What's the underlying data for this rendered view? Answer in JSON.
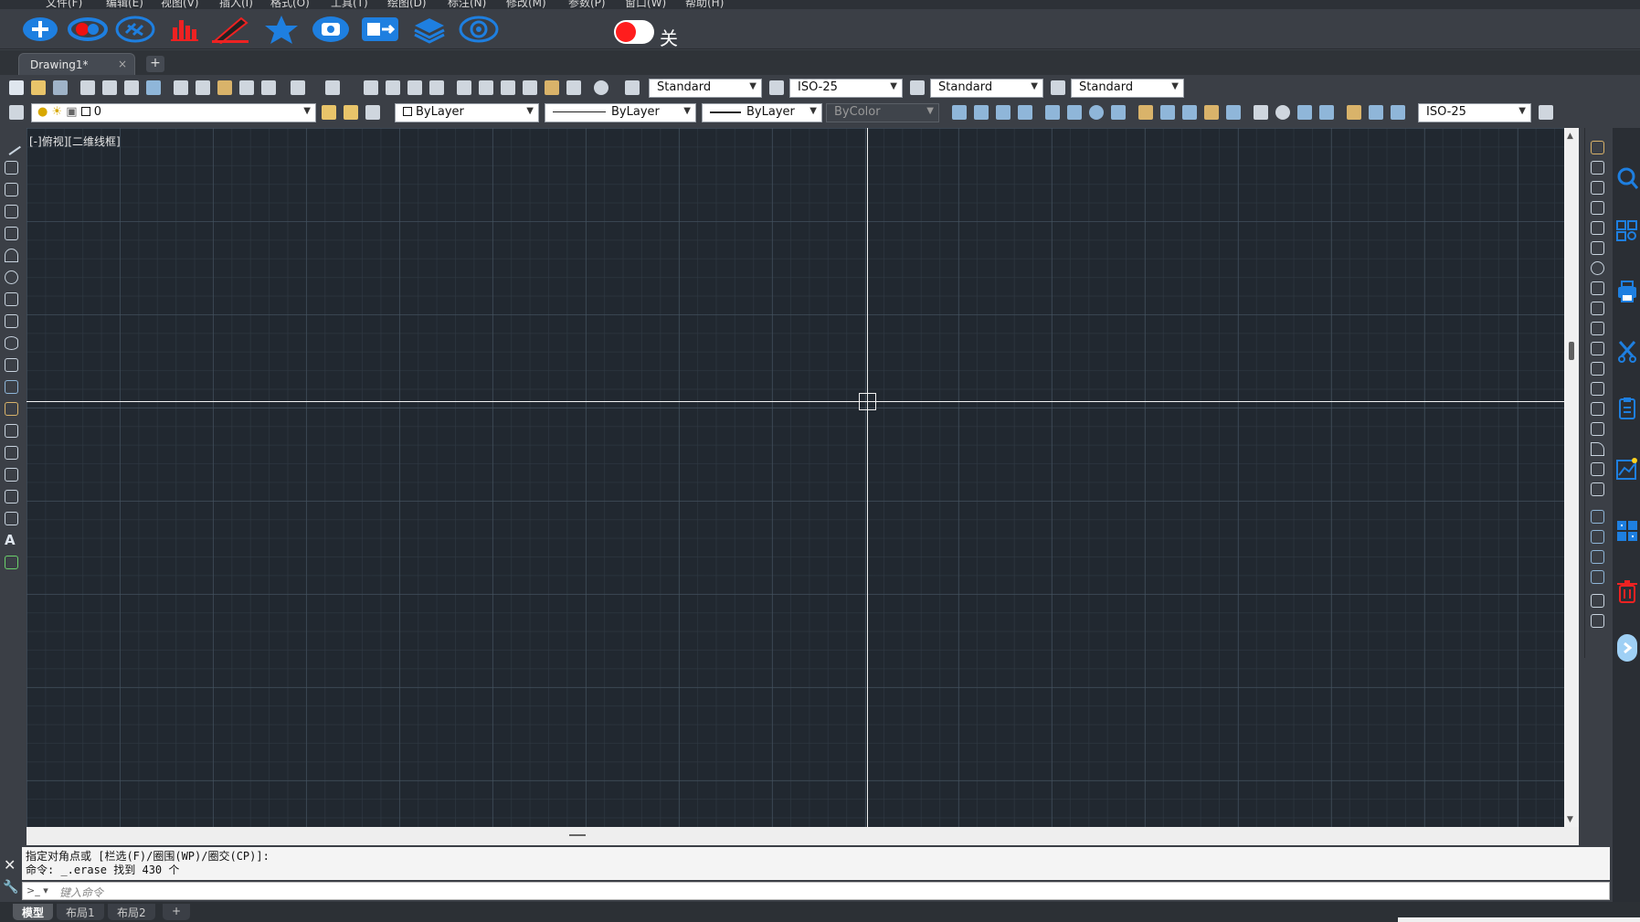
{
  "menu": [
    "文件(F)",
    "编辑(E)",
    "视图(V)",
    "插入(I)",
    "格式(O)",
    "工具(T)",
    "绘图(D)",
    "标注(N)",
    "修改(M)",
    "参数(P)",
    "窗口(W)",
    "帮助(H)"
  ],
  "quickbar": {
    "icons": [
      "plus-circle-icon",
      "eye-toggle-icon",
      "link-icon",
      "bar-chart-icon",
      "pen-icon",
      "star-icon",
      "camera-icon",
      "export-icon",
      "layers-icon",
      "settings-gear-icon"
    ],
    "toggle_label": "关",
    "accent_blue": "#1e7fe0",
    "accent_red": "#ff1d1d"
  },
  "tabs": {
    "document": "Drawing1*",
    "close": "×",
    "add": "+"
  },
  "toolbar1": {
    "text_style": "Standard",
    "dim_style": "ISO-25",
    "table_style": "Standard",
    "mleader_style": "Standard"
  },
  "toolbar2": {
    "layer": "0",
    "color": "ByLayer",
    "linetype": "ByLayer",
    "lineweight": "ByLayer",
    "plotstyle": "ByColor",
    "dim_style": "ISO-25"
  },
  "canvas": {
    "view_label": "[-]俯视][二维线框]"
  },
  "command": {
    "line1": "指定对角点或 [栏选(F)/圈围(WP)/圈交(CP)]:",
    "line2": "命令: _.erase 找到 430 个",
    "placeholder": "键入命令",
    "prompt_icon": ">_ ▾"
  },
  "layout_tabs": [
    "模型",
    "布局1",
    "布局2",
    "+"
  ]
}
